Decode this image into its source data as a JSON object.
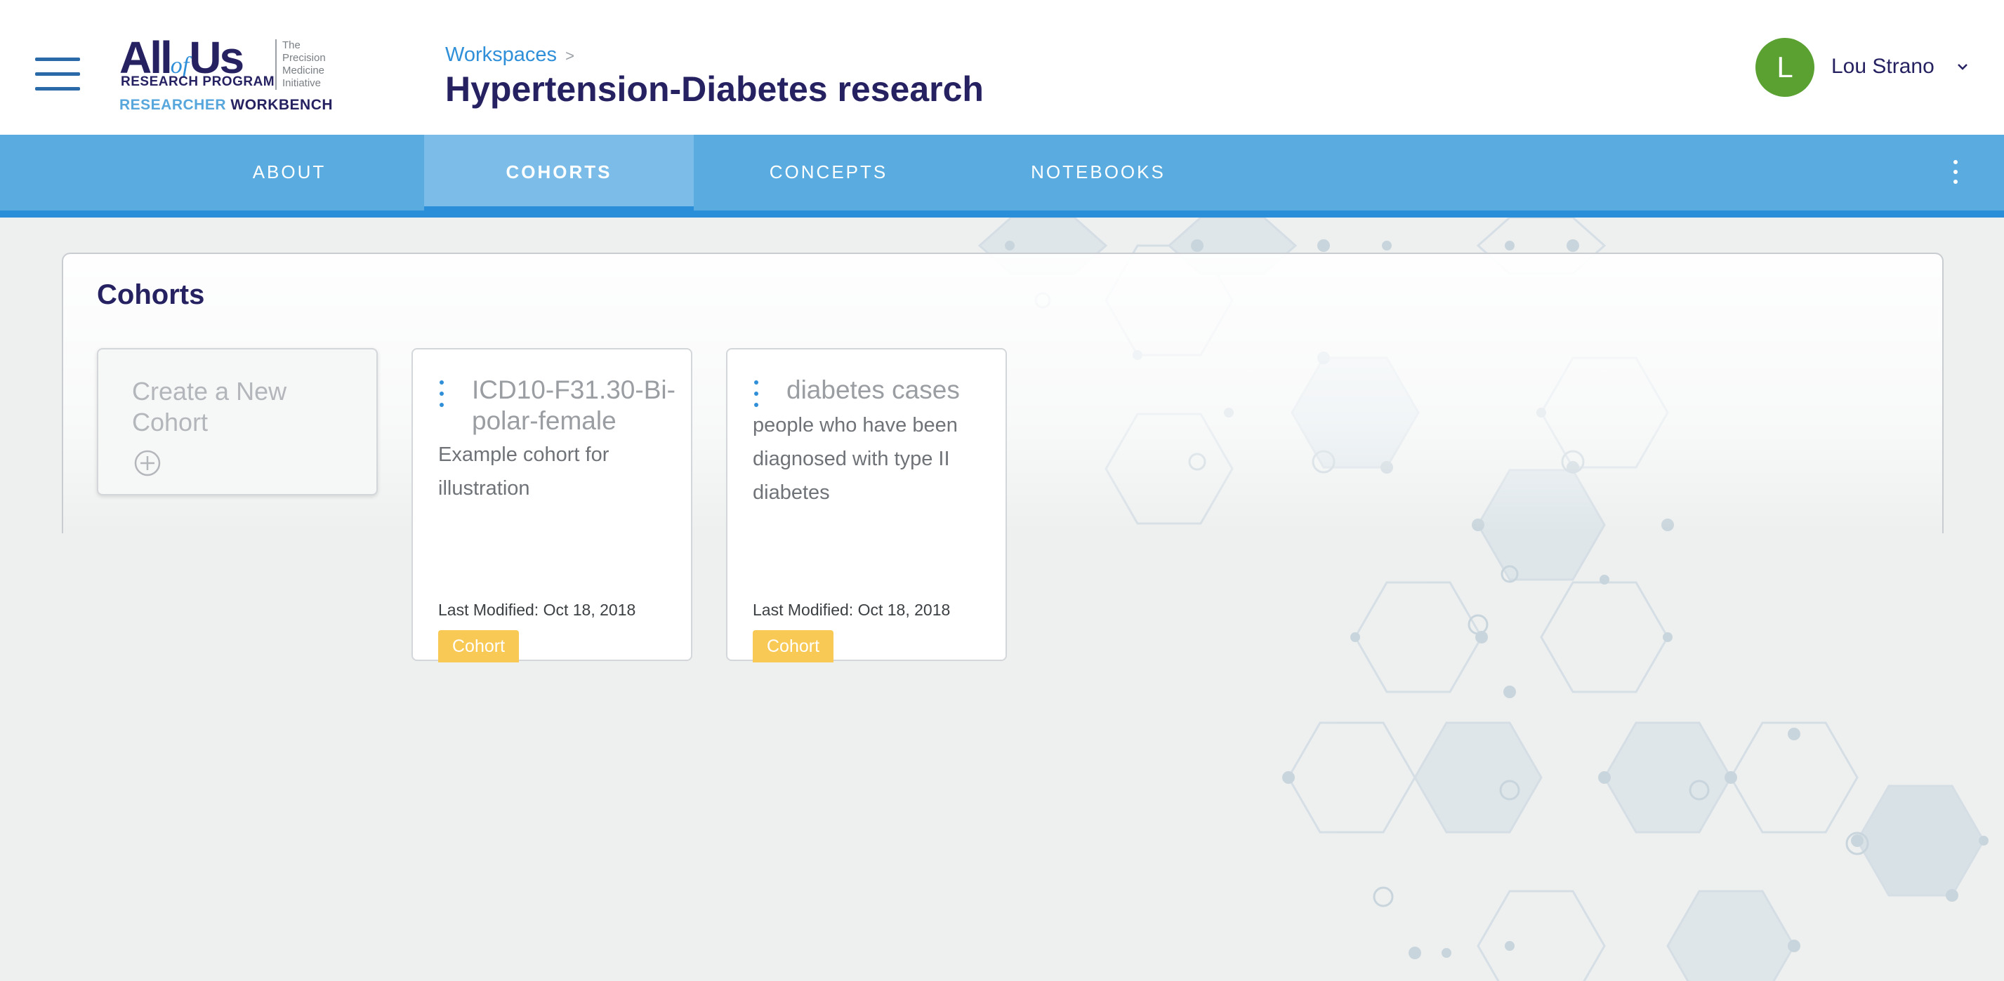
{
  "app": {
    "logo": {
      "all": "All",
      "of": "of",
      "us": "Us",
      "program": "RESEARCH PROGRAM",
      "tagline": "The Precision Medicine Initiative",
      "workbench_prefix": "RESEARCHER",
      "workbench_suffix": "WORKBENCH"
    }
  },
  "header": {
    "breadcrumb": "Workspaces",
    "breadcrumb_separator": ">",
    "title": "Hypertension-Diabetes research",
    "user": {
      "initial": "L",
      "name": "Lou Strano",
      "avatar_color": "#5aa132"
    }
  },
  "tabs": [
    {
      "label": "ABOUT",
      "active": false
    },
    {
      "label": "COHORTS",
      "active": true
    },
    {
      "label": "CONCEPTS",
      "active": false
    },
    {
      "label": "NOTEBOOKS",
      "active": false
    }
  ],
  "cohorts": {
    "heading": "Cohorts",
    "create_label": "Create a New Cohort",
    "items": [
      {
        "name": "ICD10-F31.30-Bi-polar-female",
        "description": "Example cohort for illustration",
        "last_modified": "Last Modified: Oct 18, 2018",
        "badge": "Cohort"
      },
      {
        "name": "diabetes cases",
        "description": "people who have been diagnosed with type II diabetes",
        "last_modified": "Last Modified: Oct 18, 2018",
        "badge": "Cohort"
      }
    ]
  },
  "colors": {
    "brand_navy": "#262262",
    "accent_blue": "#2f8fd8",
    "tabbar": "#5aace0",
    "badge_yellow": "#f8c954"
  }
}
